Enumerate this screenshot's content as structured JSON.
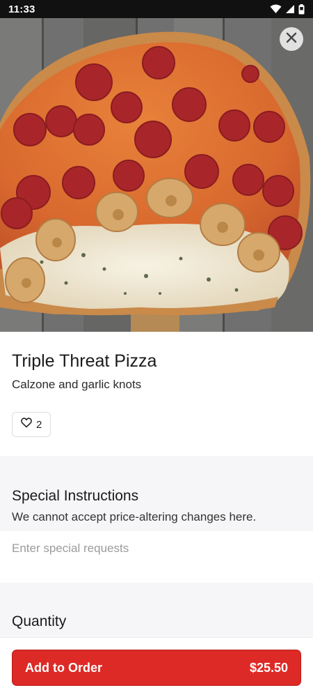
{
  "status_bar": {
    "time": "11:33",
    "icons": [
      "wifi-icon",
      "cellular-signal-icon",
      "battery-icon"
    ]
  },
  "hero": {
    "image": "pizza-photo",
    "close_icon": "close-icon"
  },
  "item": {
    "title": "Triple Threat Pizza",
    "subtitle": "Calzone and garlic knots",
    "like_icon": "heart-icon",
    "like_count": "2"
  },
  "special_instructions": {
    "title": "Special Instructions",
    "description": "We cannot accept price-altering changes here.",
    "placeholder": "Enter special requests",
    "value": ""
  },
  "quantity": {
    "title": "Quantity"
  },
  "order": {
    "button_label": "Add to Order",
    "price": "$25.50"
  },
  "colors": {
    "accent": "#dd2a26",
    "section_background": "#f6f6f8",
    "status_bar": "#111111"
  }
}
